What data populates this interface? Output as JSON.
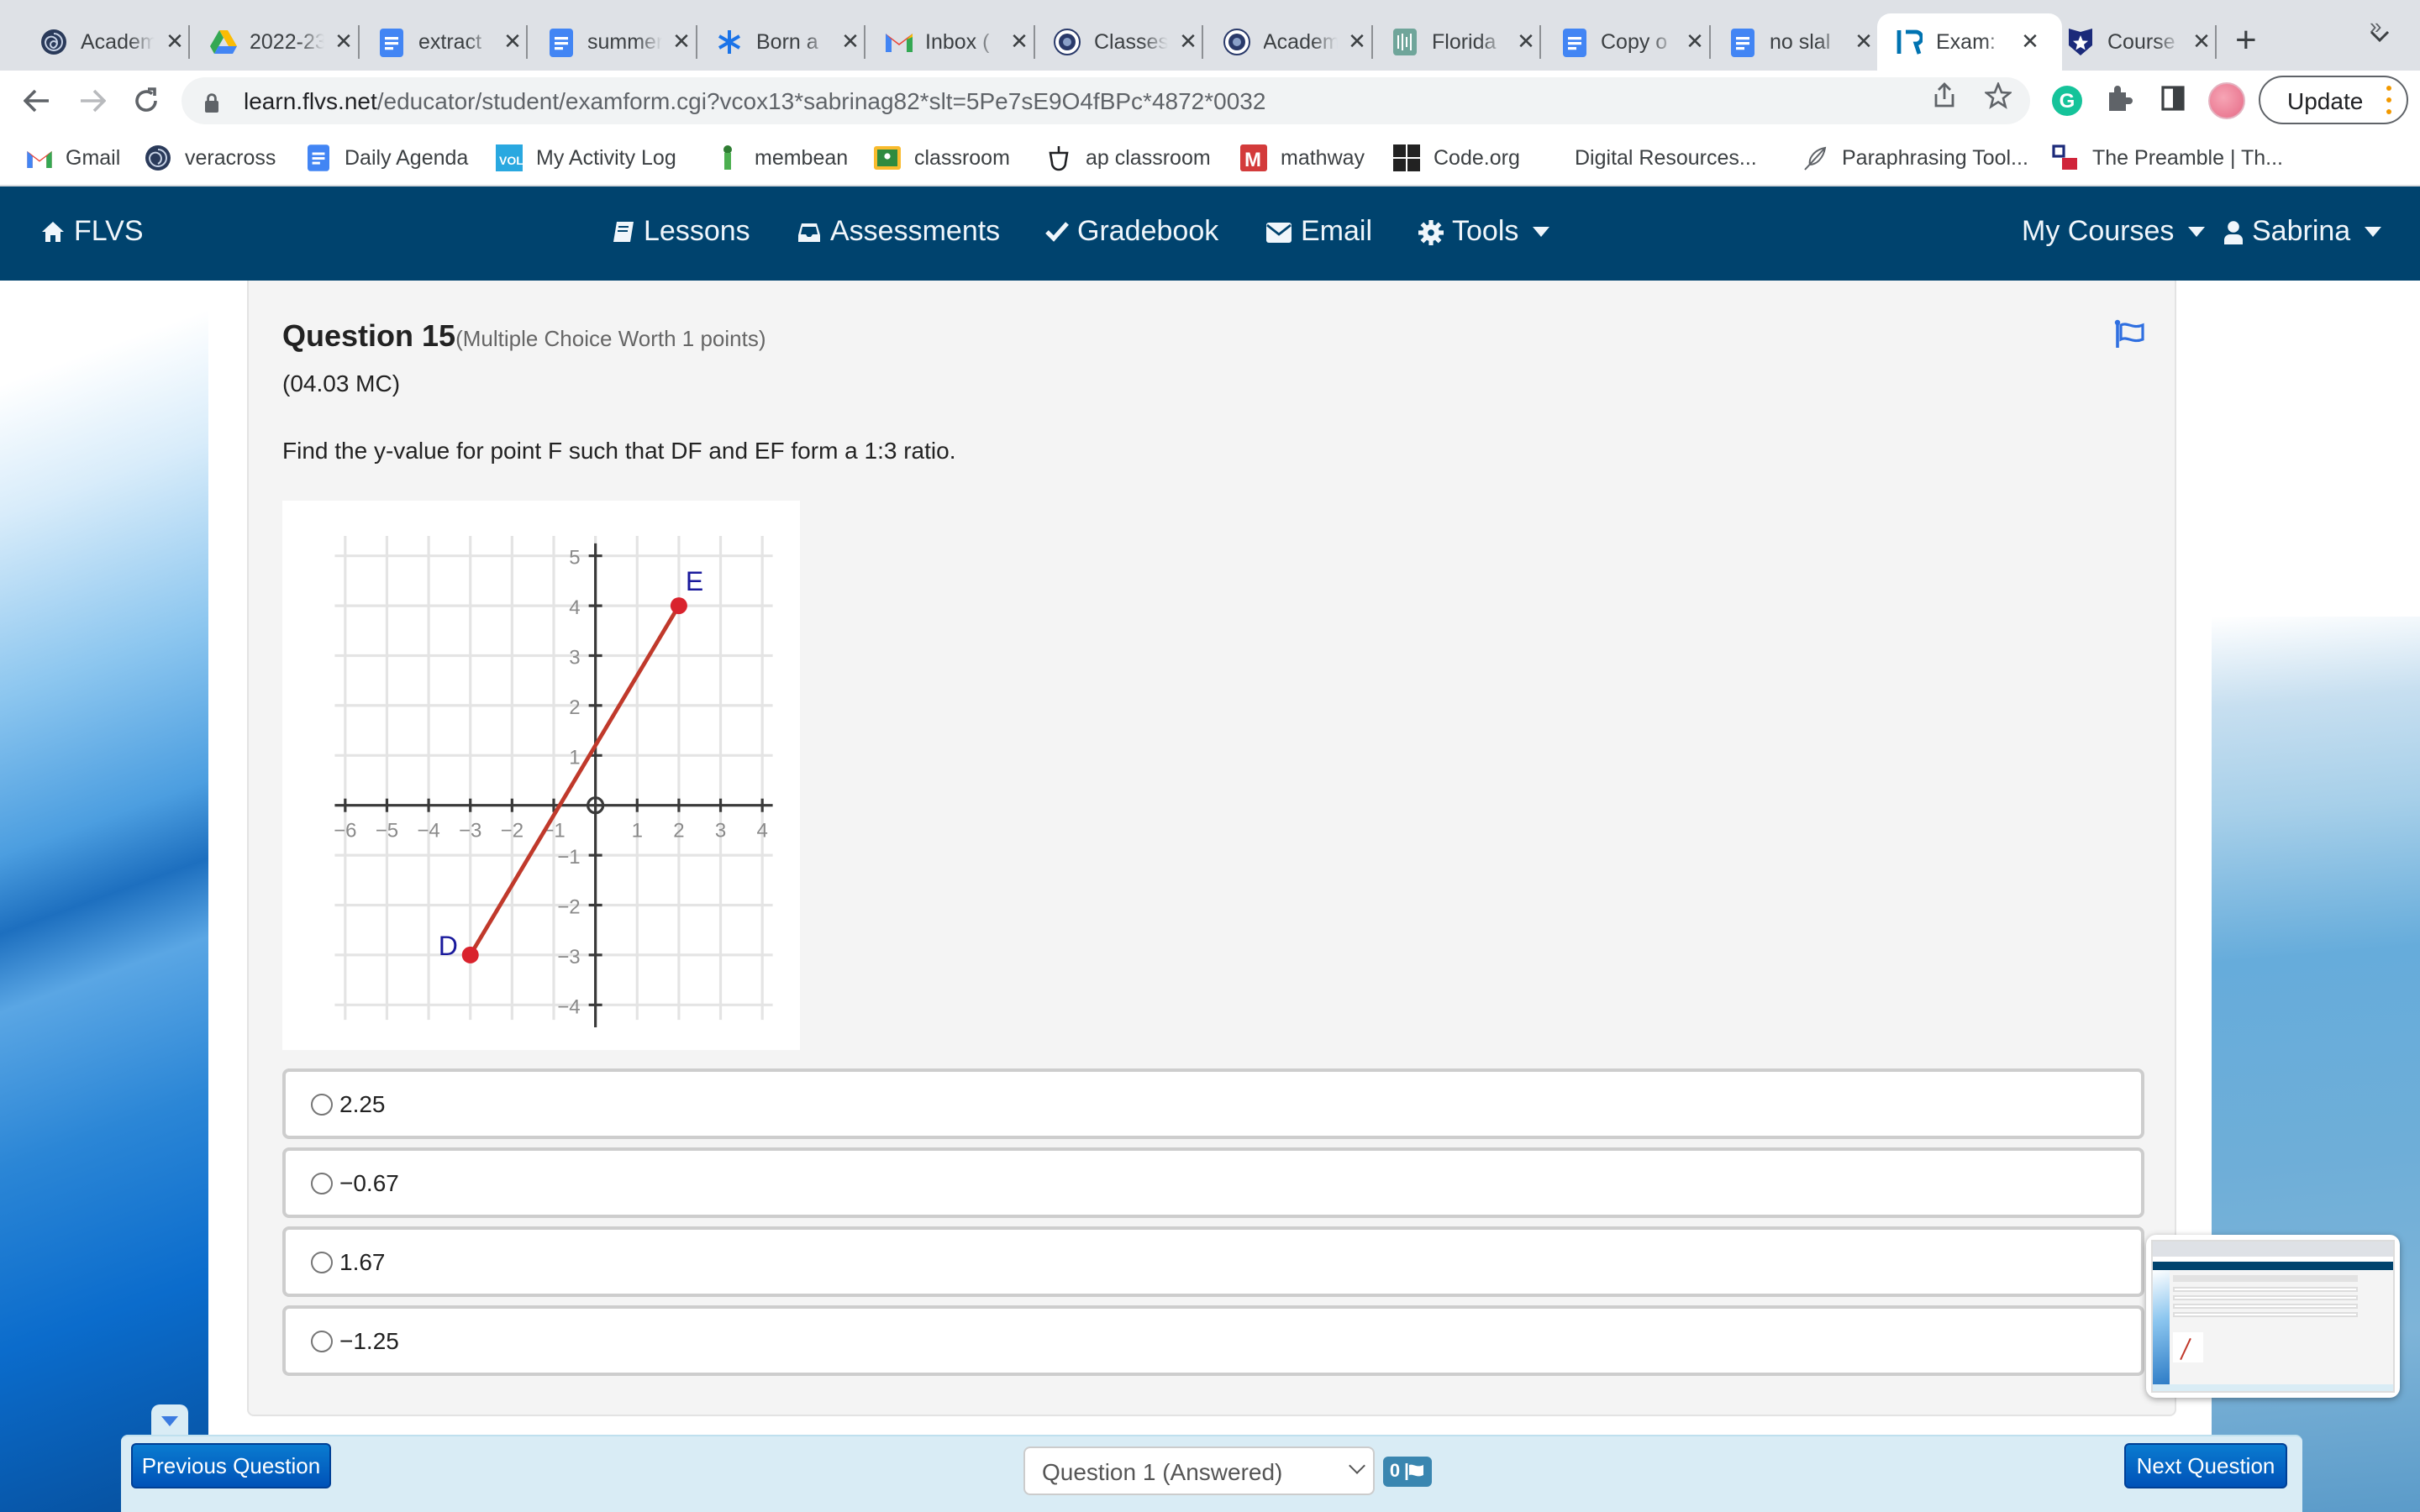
{
  "browser": {
    "tabs": [
      {
        "title": "Academ",
        "icon": "veracross-icon",
        "active": false
      },
      {
        "title": "2022-23",
        "icon": "google-drive-icon",
        "active": false
      },
      {
        "title": "extract",
        "icon": "google-docs-icon",
        "active": false
      },
      {
        "title": "summer",
        "icon": "google-docs-icon",
        "active": false
      },
      {
        "title": "Born a",
        "icon": "asterisk-icon",
        "active": false
      },
      {
        "title": "Inbox (",
        "icon": "gmail-icon",
        "active": false
      },
      {
        "title": "Classes",
        "icon": "school-seal-icon",
        "active": false
      },
      {
        "title": "Academ",
        "icon": "school-seal-icon",
        "active": false
      },
      {
        "title": "Florida",
        "icon": "florida-icon",
        "active": false
      },
      {
        "title": "Copy o",
        "icon": "google-docs-icon",
        "active": false
      },
      {
        "title": "no slal",
        "icon": "google-docs-icon",
        "active": false
      },
      {
        "title": "Exam:",
        "icon": "flvs-icon",
        "active": true
      },
      {
        "title": "Course",
        "icon": "shield-star-icon",
        "active": false
      }
    ],
    "close_glyph": "✕",
    "new_tab_glyph": "+",
    "tab_menu_glyph": "⌄",
    "url_host": "learn.flvs.net",
    "url_path": "/educator/student/examform.cgi?vcox13*sabrinag82*slt=5Pe7sE9O4fBPc*4872*0032",
    "update_label": "Update",
    "bookmarks": [
      {
        "label": "Gmail",
        "icon": "gmail-icon"
      },
      {
        "label": "veracross",
        "icon": "veracross-icon"
      },
      {
        "label": "Daily Agenda",
        "icon": "google-docs-icon"
      },
      {
        "label": "My Activity Log",
        "icon": "vol-icon"
      },
      {
        "label": "membean",
        "icon": "membean-icon"
      },
      {
        "label": "classroom",
        "icon": "google-classroom-icon"
      },
      {
        "label": "ap classroom",
        "icon": "acorn-icon"
      },
      {
        "label": "mathway",
        "icon": "mathway-icon"
      },
      {
        "label": "Code.org",
        "icon": "code-org-icon"
      },
      {
        "label": "Digital Resources...",
        "icon": ""
      },
      {
        "label": "Paraphrasing Tool...",
        "icon": "feather-icon"
      },
      {
        "label": "The Preamble | Th...",
        "icon": "preamble-icon"
      }
    ],
    "bookmarks_more": "»"
  },
  "nav": {
    "brand": "FLVS",
    "items": [
      {
        "label": "Lessons",
        "icon": "book-icon"
      },
      {
        "label": "Assessments",
        "icon": "inbox-icon"
      },
      {
        "label": "Gradebook",
        "icon": "check-icon"
      },
      {
        "label": "Email",
        "icon": "envelope-icon"
      },
      {
        "label": "Tools",
        "icon": "gear-icon",
        "dropdown": true
      }
    ],
    "my_courses": "My Courses",
    "user": "Sabrina"
  },
  "question": {
    "title": "Question 15",
    "worth": "(Multiple Choice Worth 1 points)",
    "code": "(04.03 MC)",
    "prompt": "Find the y-value for point F such that DF and EF form a 1:3 ratio.",
    "options": [
      {
        "label": "2.25",
        "selected": false
      },
      {
        "label": "−0.67",
        "selected": false
      },
      {
        "label": "1.67",
        "selected": false
      },
      {
        "label": "−1.25",
        "selected": false
      }
    ]
  },
  "chart_data": {
    "type": "line",
    "title": "",
    "xlabel": "",
    "ylabel": "",
    "xlim": [
      -6,
      4
    ],
    "ylim": [
      -4,
      5
    ],
    "grid": true,
    "x_ticks": [
      -6,
      -5,
      -4,
      -3,
      -2,
      -1,
      1,
      2,
      3,
      4
    ],
    "x_tick_labels": [
      "−6",
      "−5",
      "−4",
      "−3",
      "−2",
      "−1",
      "1",
      "2",
      "3",
      "4"
    ],
    "y_ticks": [
      -4,
      -3,
      -2,
      -1,
      1,
      2,
      3,
      4,
      5
    ],
    "y_tick_labels": [
      "−4",
      "−3",
      "−2",
      "−1",
      "1",
      "2",
      "3",
      "4",
      "5"
    ],
    "series": [
      {
        "name": "segment DE",
        "color": "#c0392b",
        "points": [
          {
            "label": "D",
            "x": -3,
            "y": -3
          },
          {
            "label": "E",
            "x": 2,
            "y": 4
          }
        ]
      }
    ],
    "point_color": "#d9232d",
    "label_color": "#1a1a9c"
  },
  "footer": {
    "prev_label": "Previous Question",
    "next_label": "Next Question",
    "question_select": "Question 1 (Answered)",
    "flag_count": "0"
  },
  "colors": {
    "nav_bg": "#00436e",
    "bottombar_bg": "#d9ecf5",
    "button_blue": "#0a6ccb",
    "flag_blue": "#2f6fe0"
  }
}
